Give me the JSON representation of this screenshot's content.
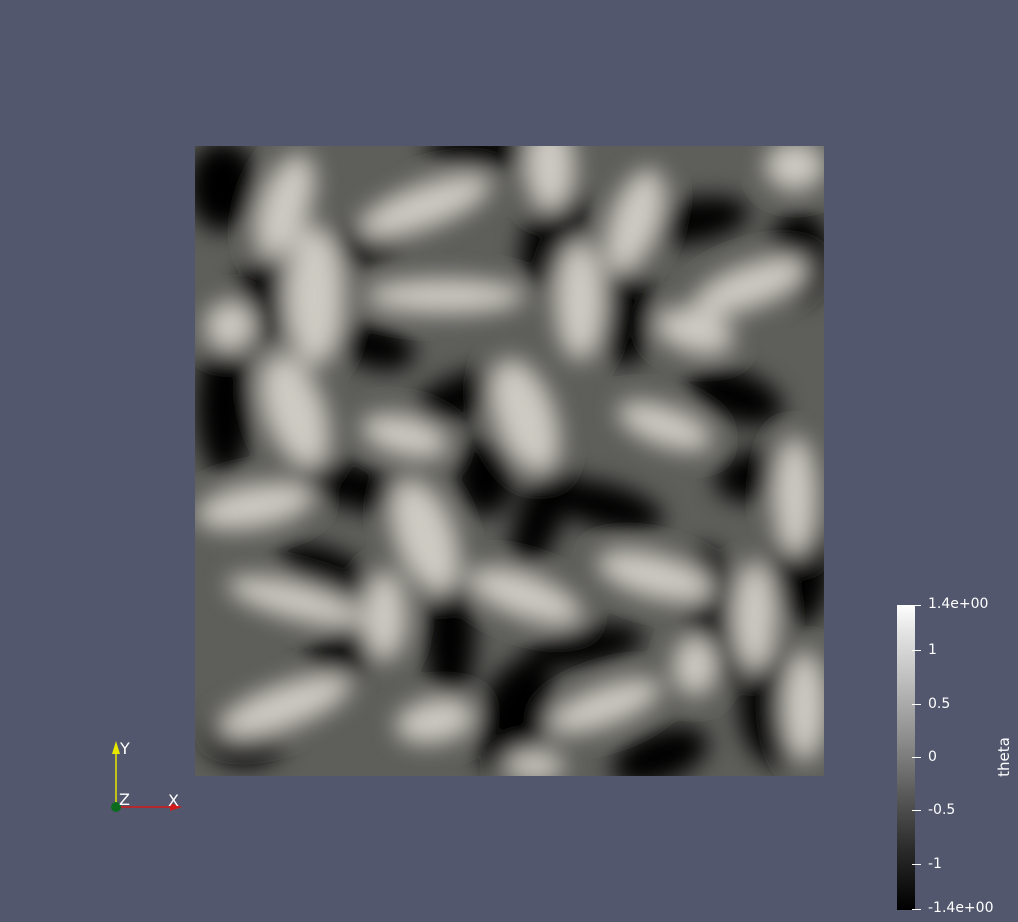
{
  "viewport": {
    "background": "#52576e"
  },
  "field": {
    "name": "theta",
    "colormap": "grayscale"
  },
  "colorbar": {
    "title": "theta",
    "ticks": [
      "1.4e+00",
      "1",
      "0.5",
      "0",
      "-0.5",
      "-1",
      "-1.4e+00"
    ]
  },
  "axes": {
    "x_label": "X",
    "y_label": "Y",
    "z_label": "Z",
    "x_color": "#d11b1b",
    "y_color": "#e7e700",
    "z_color": "#0a6b1e"
  }
}
